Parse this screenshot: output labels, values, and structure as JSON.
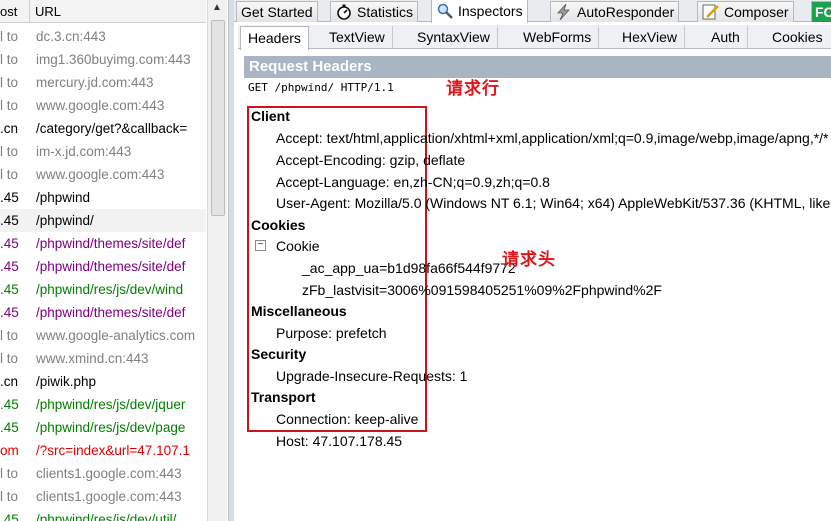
{
  "sessions": {
    "columns": [
      "ost",
      "URL"
    ],
    "rows": [
      {
        "host": "l to",
        "url": "dc.3.cn:443",
        "color": "#808080"
      },
      {
        "host": "l to",
        "url": "img1.360buyimg.com:443",
        "color": "#808080"
      },
      {
        "host": "l to",
        "url": "mercury.jd.com:443",
        "color": "#808080"
      },
      {
        "host": "l to",
        "url": "www.google.com:443",
        "color": "#808080"
      },
      {
        "host": ".cn",
        "url": "/category/get?&callback=",
        "color": "#000000"
      },
      {
        "host": "l to",
        "url": "im-x.jd.com:443",
        "color": "#808080"
      },
      {
        "host": "l to",
        "url": "www.google.com:443",
        "color": "#808080"
      },
      {
        "host": ".45",
        "url": "/phpwind",
        "color": "#000000"
      },
      {
        "host": ".45",
        "url": "/phpwind/",
        "color": "#000000"
      },
      {
        "host": ".45",
        "url": "/phpwind/themes/site/def",
        "color": "#800080"
      },
      {
        "host": ".45",
        "url": "/phpwind/themes/site/def",
        "color": "#800080"
      },
      {
        "host": ".45",
        "url": "/phpwind/res/js/dev/wind",
        "color": "#008000"
      },
      {
        "host": ".45",
        "url": "/phpwind/themes/site/def",
        "color": "#800080"
      },
      {
        "host": "l to",
        "url": "www.google-analytics.com",
        "color": "#808080"
      },
      {
        "host": "l to",
        "url": "www.xmind.cn:443",
        "color": "#808080"
      },
      {
        "host": ".cn",
        "url": "/piwik.php",
        "color": "#000000"
      },
      {
        "host": ".45",
        "url": "/phpwind/res/js/dev/jquer",
        "color": "#008000"
      },
      {
        "host": ".45",
        "url": "/phpwind/res/js/dev/page",
        "color": "#008000"
      },
      {
        "host": "om",
        "url": "/?src=index&url=47.107.1",
        "color": "#e00000"
      },
      {
        "host": "l to",
        "url": "clients1.google.com:443",
        "color": "#808080"
      },
      {
        "host": "l to",
        "url": "clients1.google.com:443",
        "color": "#808080"
      },
      {
        "host": ".45",
        "url": "/phpwind/res/js/dev/util/",
        "color": "#008000"
      }
    ],
    "selected_index": 8
  },
  "top_tabs": [
    {
      "label": "Get Started",
      "icon": ""
    },
    {
      "label": "Statistics",
      "icon": "stopwatch-icon"
    },
    {
      "label": "Inspectors",
      "icon": "magnifier-icon"
    },
    {
      "label": "AutoResponder",
      "icon": "lightning-icon"
    },
    {
      "label": "Composer",
      "icon": "pencil-icon"
    },
    {
      "label": "FC",
      "icon": ""
    }
  ],
  "sub_tabs": [
    "Headers",
    "TextView",
    "SyntaxView",
    "WebForms",
    "HexView",
    "Auth",
    "Cookies"
  ],
  "request": {
    "title": "Request Headers",
    "line": "GET /phpwind/ HTTP/1.1",
    "groups": {
      "client": {
        "name": "Client",
        "headers": [
          "Accept: text/html,application/xhtml+xml,application/xml;q=0.9,image/webp,image/apng,*/*",
          "Accept-Encoding: gzip, deflate",
          "Accept-Language: en,zh-CN;q=0.9,zh;q=0.8",
          "User-Agent: Mozilla/5.0 (Windows NT 6.1; Win64; x64) AppleWebKit/537.36 (KHTML, like Gecko)"
        ]
      },
      "cookies": {
        "name": "Cookies",
        "toggle": "−",
        "cookie_label": "Cookie",
        "values": [
          "_ac_app_ua=b1d98fa66f544f9772",
          "zFb_lastvisit=3006%091598405251%09%2Fphpwind%2F"
        ]
      },
      "misc": {
        "name": "Miscellaneous",
        "headers": [
          "Purpose: prefetch"
        ]
      },
      "security": {
        "name": "Security",
        "headers": [
          "Upgrade-Insecure-Requests: 1"
        ]
      },
      "transport": {
        "name": "Transport",
        "headers": [
          "Connection: keep-alive",
          "Host: 47.107.178.45"
        ]
      }
    }
  },
  "annotations": {
    "request_line_label": "请求行",
    "request_headers_label": "请求头",
    "color": "#e2161a"
  },
  "colors": {
    "section_header_bg": "#a9b5c3",
    "annotation_box": "#c8141a",
    "fc_badge": "#1aa34a"
  }
}
